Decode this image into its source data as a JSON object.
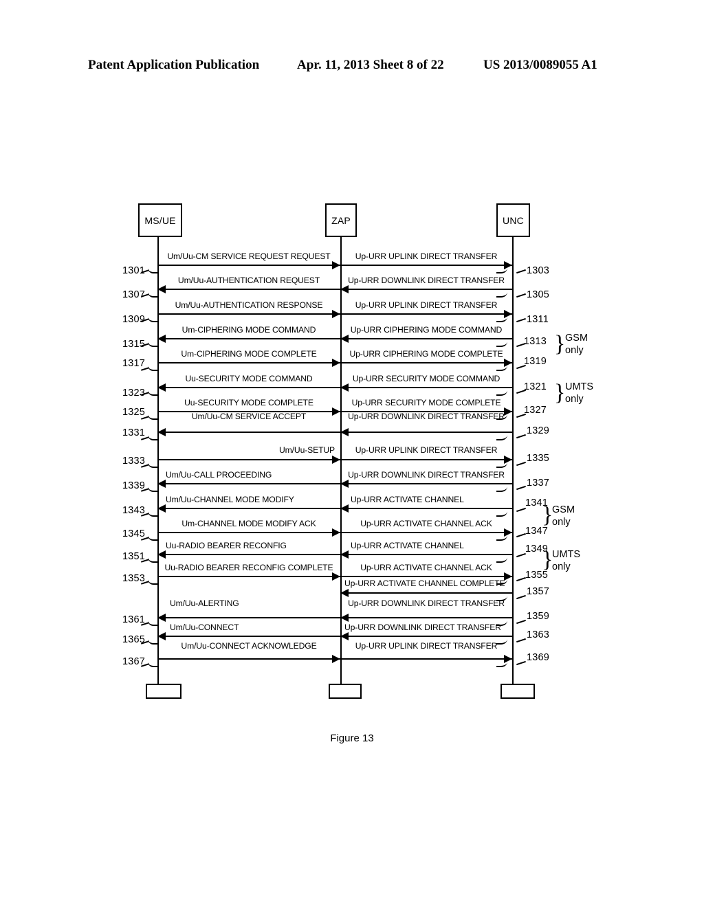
{
  "header": {
    "left": "Patent Application Publication",
    "middle": "Apr. 11, 2013  Sheet 8 of 22",
    "right": "US 2013/0089055 A1"
  },
  "figure": {
    "caption": "Figure 13",
    "actors": [
      {
        "id": "ms-ue",
        "label": "MS/UE"
      },
      {
        "id": "zap",
        "label": "ZAP"
      },
      {
        "id": "unc",
        "label": "UNC"
      }
    ],
    "rows": [
      {
        "left_label": "Um/Uu-CM SERVICE REQUEST REQUEST",
        "left_dir": "right",
        "left_ref": "1301",
        "right_label": "Up-URR UPLINK DIRECT TRANSFER",
        "right_dir": "right",
        "right_ref": "1303"
      },
      {
        "left_label": "Um/Uu-AUTHENTICATION REQUEST",
        "left_dir": "left",
        "left_ref": "1307",
        "right_label": "Up-URR DOWNLINK DIRECT TRANSFER",
        "right_dir": "left",
        "right_ref": "1305"
      },
      {
        "left_label": "Um/Uu-AUTHENTICATION RESPONSE",
        "left_dir": "right",
        "left_ref": "1309",
        "right_label": "Up-URR UPLINK DIRECT TRANSFER",
        "right_dir": "right",
        "right_ref": "1311"
      },
      {
        "left_label": "Um-CIPHERING MODE COMMAND",
        "left_dir": "left",
        "left_ref": "1315",
        "right_label": "Up-URR CIPHERING MODE COMMAND",
        "right_dir": "left",
        "right_ref": "1313"
      },
      {
        "left_label": "Um-CIPHERING MODE COMPLETE",
        "left_dir": "right",
        "left_ref": "1317",
        "right_label": "Up-URR CIPHERING MODE COMPLETE",
        "right_dir": "right",
        "right_ref": "1319"
      },
      {
        "left_label": "Uu-SECURITY MODE COMMAND",
        "left_dir": "left",
        "left_ref": "1323",
        "right_label": "Up-URR SECURITY MODE COMMAND",
        "right_dir": "left",
        "right_ref": "1321"
      },
      {
        "left_label": "Uu-SECURITY MODE COMPLETE",
        "left_dir": "right",
        "left_ref": "1325",
        "right_label": "Up-URR SECURITY MODE COMPLETE",
        "right_dir": "right",
        "right_ref": "1327"
      },
      {
        "left_label": "Um/Uu-CM SERVICE ACCEPT",
        "left_dir": "left",
        "left_ref": "1331",
        "right_label": "Up-URR DOWNLINK DIRECT TRANSFER",
        "right_dir": "left",
        "right_ref": "1329"
      },
      {
        "left_label": "Um/Uu-SETUP",
        "left_dir": "right",
        "left_ref": "1333",
        "right_label": "Up-URR UPLINK DIRECT TRANSFER",
        "right_dir": "right",
        "right_ref": "1335"
      },
      {
        "left_label": "Um/Uu-CALL PROCEEDING",
        "left_dir": "left",
        "left_ref": "1339",
        "right_label": "Up-URR DOWNLINK DIRECT TRANSFER",
        "right_dir": "left",
        "right_ref": "1337"
      },
      {
        "left_label": "Um/Uu-CHANNEL MODE MODIFY",
        "left_dir": "left",
        "left_ref": "1343",
        "right_label": "Up-URR ACTIVATE CHANNEL",
        "right_dir": "left",
        "right_ref": "1341"
      },
      {
        "left_label": "Um-CHANNEL MODE MODIFY ACK",
        "left_dir": "right",
        "left_ref": "1345",
        "right_label": "Up-URR ACTIVATE CHANNEL ACK",
        "right_dir": "right",
        "right_ref": "1347"
      },
      {
        "left_label": "Uu-RADIO BEARER RECONFIG",
        "left_dir": "left",
        "left_ref": "1351",
        "right_label": "Up-URR ACTIVATE CHANNEL",
        "right_dir": "left",
        "right_ref": "1349"
      },
      {
        "left_label": "Uu-RADIO BEARER RECONFIG COMPLETE",
        "left_dir": "right",
        "left_ref": "1353",
        "right_label": "Up-URR ACTIVATE CHANNEL ACK",
        "right_dir": "right",
        "right_ref": "1355"
      },
      {
        "left_label": "",
        "left_dir": "none",
        "left_ref": "",
        "right_label": "Up-URR ACTIVATE CHANNEL COMPLETE",
        "right_dir": "left",
        "right_ref": "1357"
      },
      {
        "left_label": "Um/Uu-ALERTING",
        "left_dir": "left",
        "left_ref": "1361",
        "right_label": "Up-URR DOWNLINK DIRECT TRANSFER",
        "right_dir": "left",
        "right_ref": "1359"
      },
      {
        "left_label": "Um/Uu-CONNECT",
        "left_dir": "left",
        "left_ref": "1365",
        "right_label": "Up-URR DOWNLINK DIRECT TRANSFER",
        "right_dir": "left",
        "right_ref": "1363"
      },
      {
        "left_label": "Um/Uu-CONNECT ACKNOWLEDGE",
        "left_dir": "right",
        "left_ref": "1367",
        "right_label": "Up-URR UPLINK DIRECT TRANSFER",
        "right_dir": "right",
        "right_ref": "1369"
      }
    ],
    "groups": [
      {
        "id": "group-gsm-ciphering",
        "line1": "GSM",
        "line2": "only"
      },
      {
        "id": "group-umts-security",
        "line1": "UMTS",
        "line2": "only"
      },
      {
        "id": "group-gsm-channel",
        "line1": "GSM",
        "line2": "only"
      },
      {
        "id": "group-umts-bearer",
        "line1": "UMTS",
        "line2": "only"
      }
    ]
  }
}
